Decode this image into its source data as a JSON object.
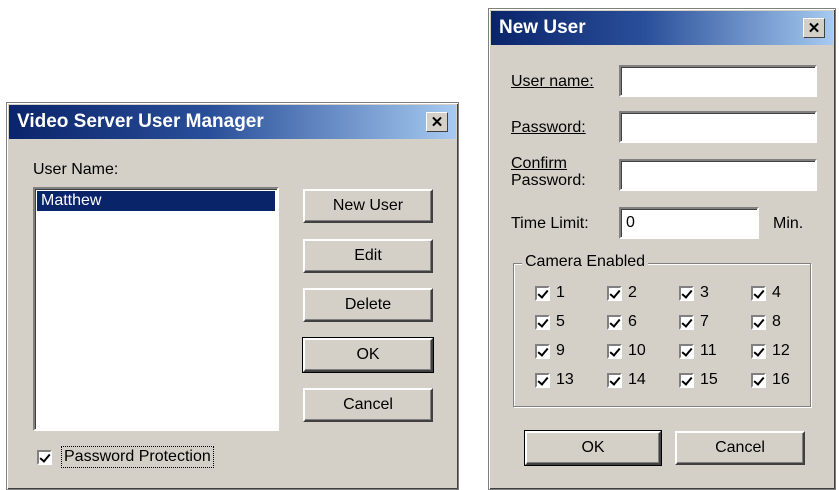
{
  "user_manager": {
    "title": "Video Server User Manager",
    "user_name_label": "User Name:",
    "users": [
      "Matthew"
    ],
    "buttons": {
      "new_user": "New User",
      "edit": "Edit",
      "delete": "Delete",
      "ok": "OK",
      "cancel": "Cancel"
    },
    "password_protection_label": "Password Protection",
    "password_protection_checked": true
  },
  "new_user": {
    "title": "New User",
    "user_name_label": "User name:",
    "password_label": "Password:",
    "confirm_label_1": "Confirm",
    "confirm_label_2": "Password:",
    "time_limit_label": "Time Limit:",
    "time_limit_value": "0",
    "time_limit_unit": "Min.",
    "camera_group_label": "Camera Enabled",
    "cameras": [
      "1",
      "2",
      "3",
      "4",
      "5",
      "6",
      "7",
      "8",
      "9",
      "10",
      "11",
      "12",
      "13",
      "14",
      "15",
      "16"
    ],
    "ok_label": "OK",
    "cancel_label": "Cancel"
  },
  "close_glyph": "✕",
  "colors": {
    "titlebar_start": "#0a246a",
    "titlebar_end": "#a6caf0",
    "dialog_face": "#d4d0c8",
    "selection": "#0a246a"
  }
}
